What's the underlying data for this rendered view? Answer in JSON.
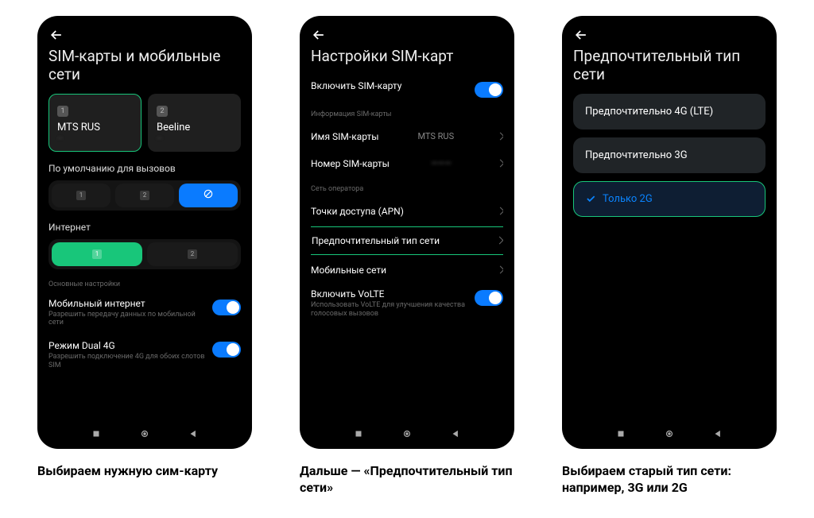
{
  "screen1": {
    "title": "SIM-карты и мобильные сети",
    "sim_cards": [
      {
        "badge": "1",
        "name": "MTS RUS",
        "sub": "—"
      },
      {
        "badge": "2",
        "name": "Beeline",
        "sub": "—"
      }
    ],
    "default_calls_label": "По умолчанию для вызовов",
    "internet_label": "Интернет",
    "settings_header": "Основные настройки",
    "mobile_internet": {
      "title": "Мобильный интернет",
      "desc": "Разрешить передачу данных по мобильной сети"
    },
    "dual4g": {
      "title": "Режим Dual 4G",
      "desc": "Разрешить подключение 4G для обоих слотов SIM"
    },
    "caption": "Выбираем нужную сим-карту"
  },
  "screen2": {
    "title": "Настройки SIM-карт",
    "enable_sim": "Включить SIM-карту",
    "info_header": "Информация SIM-карты",
    "sim_name_label": "Имя SIM-карты",
    "sim_name_value": "MTS RUS",
    "sim_number_label": "Номер SIM-карты",
    "sim_number_value": "———",
    "operator_header": "Сеть оператора",
    "apn_label": "Точки доступа (APN)",
    "pref_net_label": "Предпочтительный тип сети",
    "mobile_nets_label": "Мобильные сети",
    "volte": {
      "title": "Включить VoLTE",
      "desc": "Использовать VoLTE для улучшения качества голосовых вызовов"
    },
    "caption": "Дальше — «Предпочтительный тип сети»"
  },
  "screen3": {
    "title": "Предпочтительный тип сети",
    "options": [
      "Предпочтительно 4G (LTE)",
      "Предпочтительно 3G",
      "Только 2G"
    ],
    "caption": "Выбираем старый тип сети: например, 3G или 2G"
  }
}
